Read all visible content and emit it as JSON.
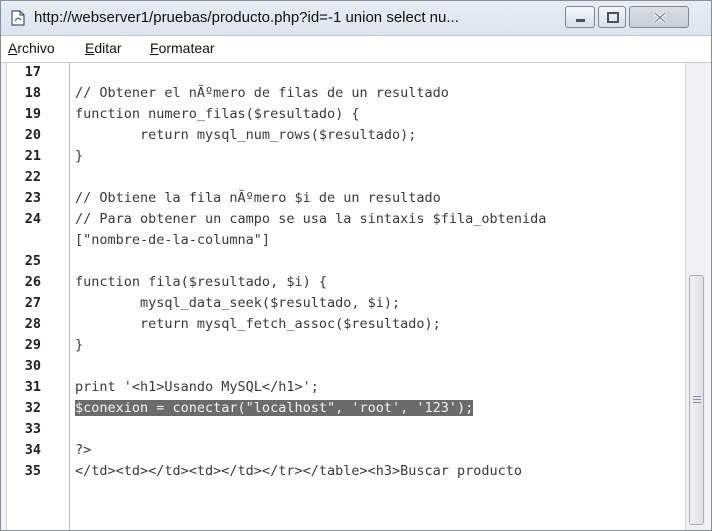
{
  "window": {
    "title": "http://webserver1/pruebas/producto.php?id=-1 union select nu..."
  },
  "menu": [
    {
      "accel": "A",
      "rest": "rchivo"
    },
    {
      "accel": "E",
      "rest": "ditar"
    },
    {
      "accel": "F",
      "rest": "ormatear"
    }
  ],
  "icons": {
    "page": "page-icon",
    "minimize": "minimize-icon",
    "maximize": "maximize-icon",
    "close": "close-icon"
  },
  "editor": {
    "lines": [
      {
        "num": "17",
        "text": ""
      },
      {
        "num": "18",
        "text": "// Obtener el nÃºmero de filas de un resultado"
      },
      {
        "num": "19",
        "text": "function numero_filas($resultado) {"
      },
      {
        "num": "20",
        "text": "        return mysql_num_rows($resultado);"
      },
      {
        "num": "21",
        "text": "}"
      },
      {
        "num": "22",
        "text": ""
      },
      {
        "num": "23",
        "text": "// Obtiene la fila nÃºmero $i de un resultado"
      },
      {
        "num": "24",
        "text": "// Para obtener un campo se usa la sintaxis $fila_obtenida"
      },
      {
        "num": "",
        "text": "[\"nombre-de-la-columna\"]"
      },
      {
        "num": "25",
        "text": ""
      },
      {
        "num": "26",
        "text": "function fila($resultado, $i) {"
      },
      {
        "num": "27",
        "text": "        mysql_data_seek($resultado, $i);"
      },
      {
        "num": "28",
        "text": "        return mysql_fetch_assoc($resultado);"
      },
      {
        "num": "29",
        "text": "}"
      },
      {
        "num": "30",
        "text": ""
      },
      {
        "num": "31",
        "text": "print '<h1>Usando MySQL</h1>';"
      },
      {
        "num": "32",
        "text": "$conexion = conectar(\"localhost\", 'root', '123');",
        "highlight": true
      },
      {
        "num": "33",
        "text": ""
      },
      {
        "num": "34",
        "text": "?>"
      },
      {
        "num": "35",
        "text": "</td><td></td><td></td></tr></table><h3>Buscar producto"
      }
    ]
  }
}
